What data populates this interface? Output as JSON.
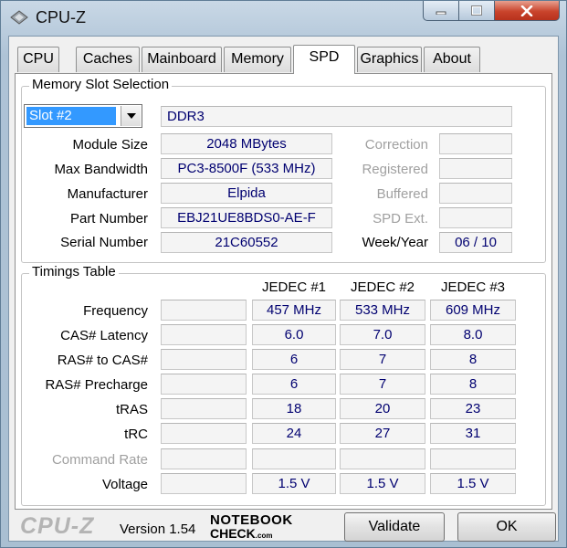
{
  "window": {
    "title": "CPU-Z"
  },
  "tabs": [
    {
      "label": "CPU"
    },
    {
      "label": "Caches"
    },
    {
      "label": "Mainboard"
    },
    {
      "label": "Memory"
    },
    {
      "label": "SPD",
      "active": true
    },
    {
      "label": "Graphics"
    },
    {
      "label": "About"
    }
  ],
  "slot": {
    "group_title": "Memory Slot Selection",
    "selected": "Slot #2",
    "type": "DDR3",
    "labels": {
      "module_size": "Module Size",
      "max_bandwidth": "Max Bandwidth",
      "manufacturer": "Manufacturer",
      "part_number": "Part Number",
      "serial_number": "Serial Number",
      "correction": "Correction",
      "registered": "Registered",
      "buffered": "Buffered",
      "spd_ext": "SPD Ext.",
      "week_year": "Week/Year"
    },
    "values": {
      "module_size": "2048 MBytes",
      "max_bandwidth": "PC3-8500F (533 MHz)",
      "manufacturer": "Elpida",
      "part_number": "EBJ21UE8BDS0-AE-F",
      "serial_number": "21C60552",
      "correction": "",
      "registered": "",
      "buffered": "",
      "spd_ext": "",
      "week_year": "06 / 10"
    }
  },
  "timings": {
    "group_title": "Timings Table",
    "columns": [
      "JEDEC #1",
      "JEDEC #2",
      "JEDEC #3"
    ],
    "rows": [
      {
        "label": "Frequency",
        "extra": "",
        "values": [
          "457 MHz",
          "533 MHz",
          "609 MHz"
        ]
      },
      {
        "label": "CAS# Latency",
        "extra": "",
        "values": [
          "6.0",
          "7.0",
          "8.0"
        ]
      },
      {
        "label": "RAS# to CAS#",
        "extra": "",
        "values": [
          "6",
          "7",
          "8"
        ]
      },
      {
        "label": "RAS# Precharge",
        "extra": "",
        "values": [
          "6",
          "7",
          "8"
        ]
      },
      {
        "label": "tRAS",
        "extra": "",
        "values": [
          "18",
          "20",
          "23"
        ]
      },
      {
        "label": "tRC",
        "extra": "",
        "values": [
          "24",
          "27",
          "31"
        ]
      },
      {
        "label": "Command Rate",
        "extra": "",
        "disabled": true,
        "values": [
          "",
          "",
          ""
        ]
      },
      {
        "label": "Voltage",
        "extra": "",
        "values": [
          "1.5 V",
          "1.5 V",
          "1.5 V"
        ]
      }
    ]
  },
  "footer": {
    "brand": "CPU-Z",
    "version": "Version 1.54",
    "watermark_line1": "NOTEBOOK",
    "watermark_line2": "CHECK",
    "watermark_suffix": ".com",
    "validate_label": "Validate",
    "ok_label": "OK"
  }
}
